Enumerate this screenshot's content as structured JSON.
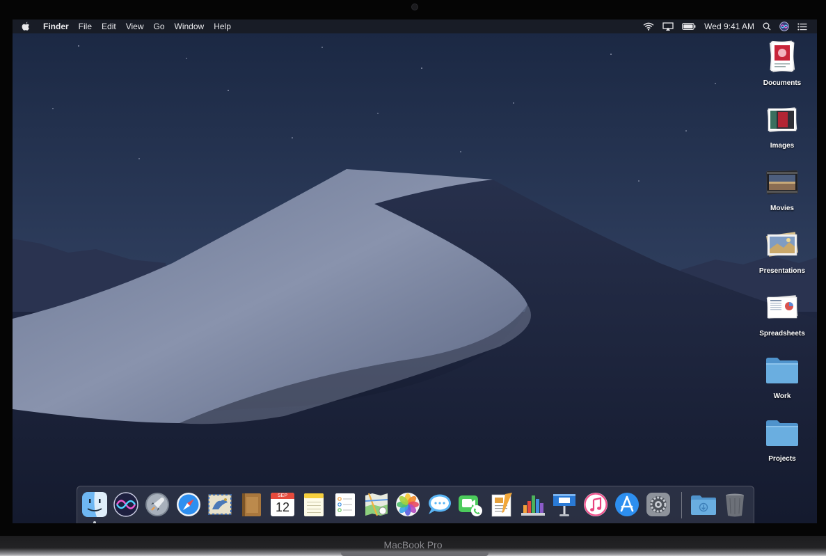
{
  "menubar": {
    "app_name": "Finder",
    "items": [
      "File",
      "Edit",
      "View",
      "Go",
      "Window",
      "Help"
    ],
    "clock": "Wed 9:41 AM"
  },
  "desktop": {
    "items": [
      {
        "label": "Documents",
        "icon": "documents-stack-icon"
      },
      {
        "label": "Images",
        "icon": "images-stack-icon"
      },
      {
        "label": "Movies",
        "icon": "movies-stack-icon"
      },
      {
        "label": "Presentations",
        "icon": "presentations-stack-icon"
      },
      {
        "label": "Spreadsheets",
        "icon": "spreadsheets-stack-icon"
      },
      {
        "label": "Work",
        "icon": "folder-icon"
      },
      {
        "label": "Projects",
        "icon": "folder-icon"
      }
    ]
  },
  "dock": {
    "calendar": {
      "month": "SEP",
      "day": "12"
    },
    "apps": [
      "finder",
      "siri",
      "launchpad",
      "safari",
      "mail",
      "contacts",
      "calendar",
      "notes",
      "reminders",
      "maps",
      "photos",
      "messages",
      "facetime",
      "pages",
      "numbers",
      "keynote",
      "itunes",
      "app-store",
      "system-preferences"
    ],
    "extras": [
      "downloads-folder",
      "trash"
    ]
  },
  "device": {
    "label": "MacBook Pro"
  },
  "colors": {
    "menubar_bg": "#181a20",
    "folder_blue": "#6aaee0",
    "dock_bg": "#3c4254"
  }
}
